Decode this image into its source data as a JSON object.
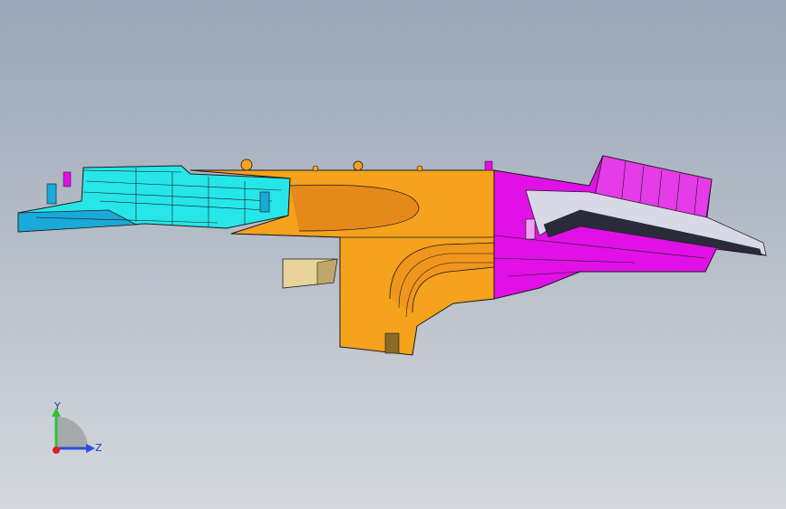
{
  "viewport": {
    "part_colors": {
      "cyan_section": "#27e6ea",
      "orange_section": "#f5a21c",
      "magenta_section": "#e010e6",
      "tan_bracket": "#e8d49a",
      "edge_lines": "#1a1a1a"
    },
    "background_gradient": [
      "#9aa7b6",
      "#d4d8de"
    ]
  },
  "triad": {
    "y_label": "Y",
    "z_label": "Z",
    "y_color": "#2ec23a",
    "z_color": "#2a4fe0",
    "origin_color": "#e02020"
  }
}
